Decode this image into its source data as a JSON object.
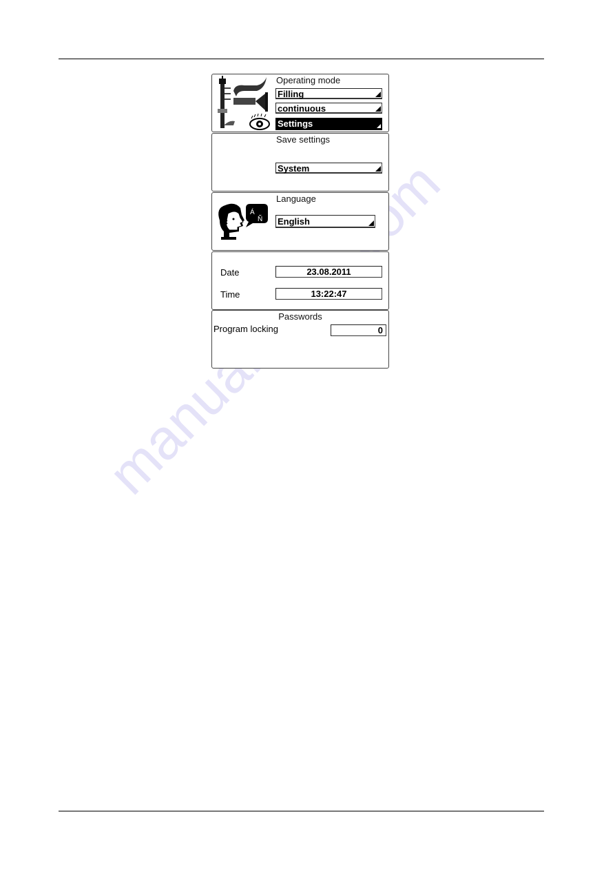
{
  "watermark": "manualshive.com",
  "panels": {
    "operating_mode": {
      "title": "Operating mode",
      "icon": "filling-machine-eye-icon",
      "fields": [
        {
          "value": "Filling",
          "selected": false
        },
        {
          "value": "continuous",
          "selected": false
        },
        {
          "value": "Settings",
          "selected": true
        }
      ]
    },
    "save_settings": {
      "title": "Save settings",
      "field": "System"
    },
    "language": {
      "title": "Language",
      "icon": "speaking-head-language-icon",
      "icon_glyphs": [
        "Á",
        "Ñ"
      ],
      "field": "English"
    },
    "date_time": {
      "date_label": "Date",
      "date_value": "23.08.2011",
      "time_label": "Time",
      "time_value": "13:22:47"
    },
    "passwords": {
      "title": "Passwords",
      "program_locking_label": "Program locking",
      "program_locking_value": "0"
    }
  }
}
